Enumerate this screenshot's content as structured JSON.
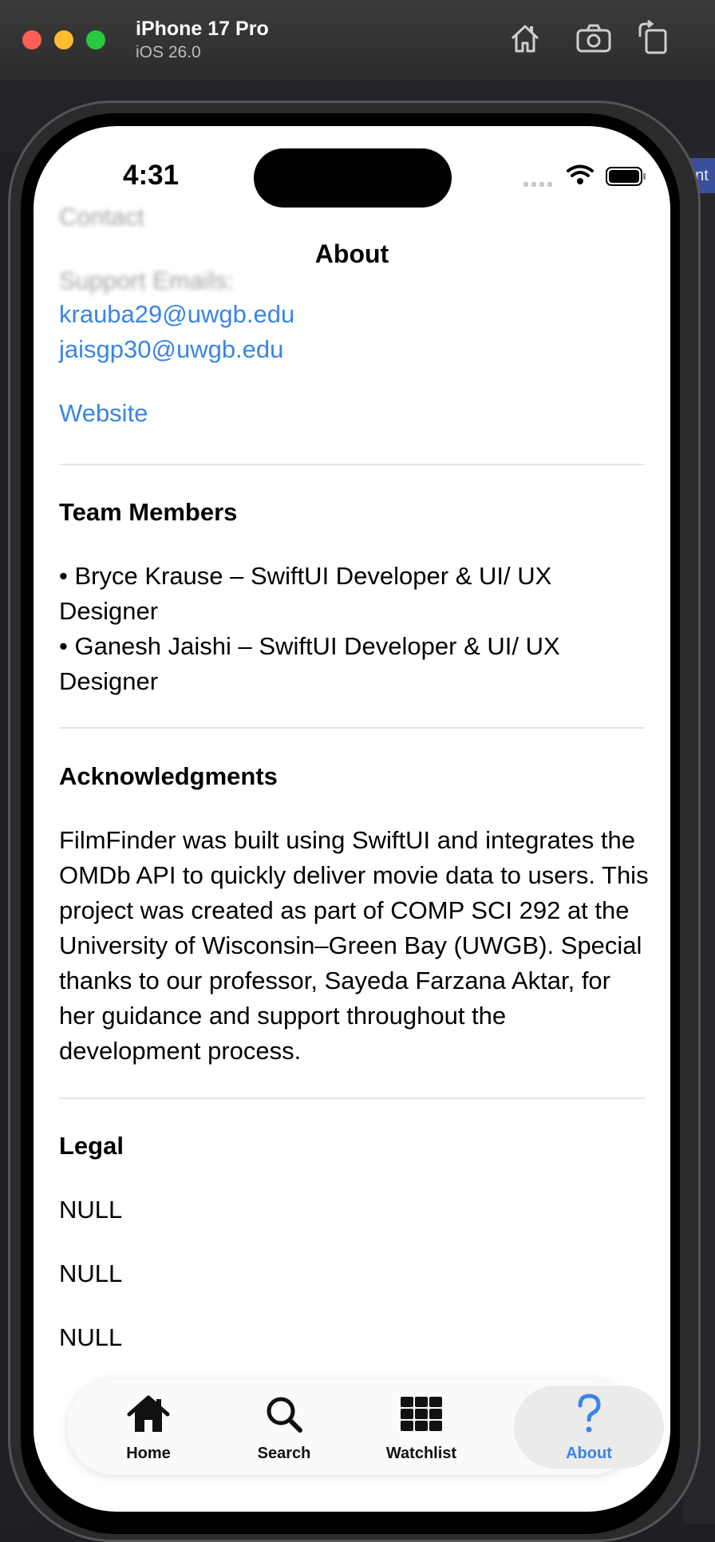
{
  "simulator": {
    "device": "iPhone 17 Pro",
    "os": "iOS 26.0"
  },
  "ide": {
    "right_tab_text": "ent"
  },
  "status_bar": {
    "time": "4:31"
  },
  "nav": {
    "title": "About"
  },
  "contact": {
    "section_label": "Contact",
    "support_label": "Support Emails:",
    "emails": [
      "krauba29@uwgb.edu",
      "jaisgp30@uwgb.edu"
    ],
    "website_label": "Website"
  },
  "team": {
    "heading": "Team Members",
    "members": [
      "• Bryce Krause – SwiftUI Developer & UI/ UX Designer",
      "• Ganesh Jaishi – SwiftUI Developer & UI/ UX Designer"
    ]
  },
  "acknowledgments": {
    "heading": "Acknowledgments",
    "text": "FilmFinder was built using SwiftUI and integrates the OMDb API to quickly deliver movie data to users. This project was created as part of COMP SCI 292 at the University of Wisconsin–Green Bay (UWGB). Special thanks to our professor, Sayeda Farzana Aktar, for her guidance and support throughout the development process."
  },
  "legal": {
    "heading": "Legal",
    "items": [
      "NULL",
      "NULL",
      "NULL"
    ]
  },
  "tabs": [
    {
      "label": "Home",
      "icon": "house-icon"
    },
    {
      "label": "Search",
      "icon": "magnifying-glass-icon"
    },
    {
      "label": "Watchlist",
      "icon": "grid-icon"
    },
    {
      "label": "About",
      "icon": "question-mark-icon",
      "selected": true
    }
  ],
  "colors": {
    "accent": "#3a85e6",
    "divider": "#e6e6e6"
  }
}
